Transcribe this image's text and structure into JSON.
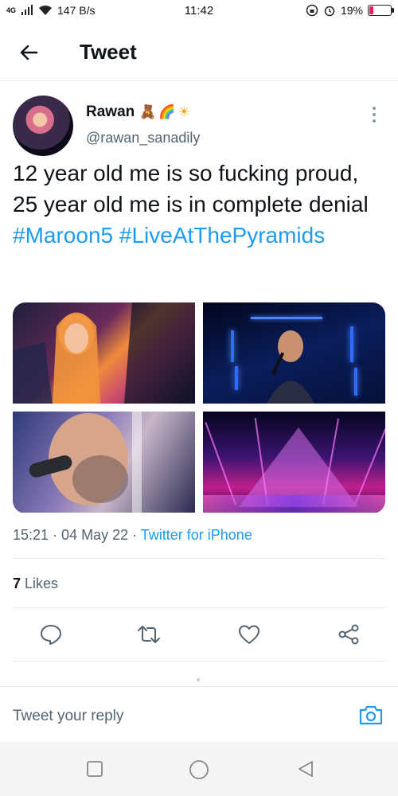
{
  "status_bar": {
    "network": "4G",
    "speed": "147 B/s",
    "time": "11:42",
    "battery": "19%",
    "battery_level": 0.19,
    "battery_color": "#e0245e"
  },
  "header": {
    "title": "Tweet",
    "back_icon": "arrow-left-icon"
  },
  "tweet": {
    "author_name": "Rawan",
    "author_emojis": [
      "🧸",
      "🌈",
      "☀"
    ],
    "handle": "@rawan_sanadily",
    "text_plain": "12 year old me is so fucking proud, 25 year old me is in complete denial ",
    "hashtag_1": "#Maroon5",
    "hashtag_2": "#LiveAtThePyramids",
    "time": "15:21 · 04 May 22 · ",
    "source": "Twitter for iPhone",
    "likes_count": "7",
    "likes_label": " Likes",
    "media": [
      {
        "name": "photo-fan-at-concert"
      },
      {
        "name": "photo-singer-blue-lights"
      },
      {
        "name": "photo-singer-closeup"
      },
      {
        "name": "photo-pyramid-stage"
      }
    ]
  },
  "actions": [
    {
      "name": "reply-button",
      "icon": "comment-icon"
    },
    {
      "name": "retweet-button",
      "icon": "retweet-icon"
    },
    {
      "name": "like-button",
      "icon": "heart-icon"
    },
    {
      "name": "share-button",
      "icon": "share-icon"
    }
  ],
  "reply": {
    "placeholder": "Tweet your reply",
    "camera_icon": "camera-icon"
  },
  "colors": {
    "accent": "#1d9bf0",
    "secondary_text": "#536471",
    "divider": "#e6ecf0"
  }
}
